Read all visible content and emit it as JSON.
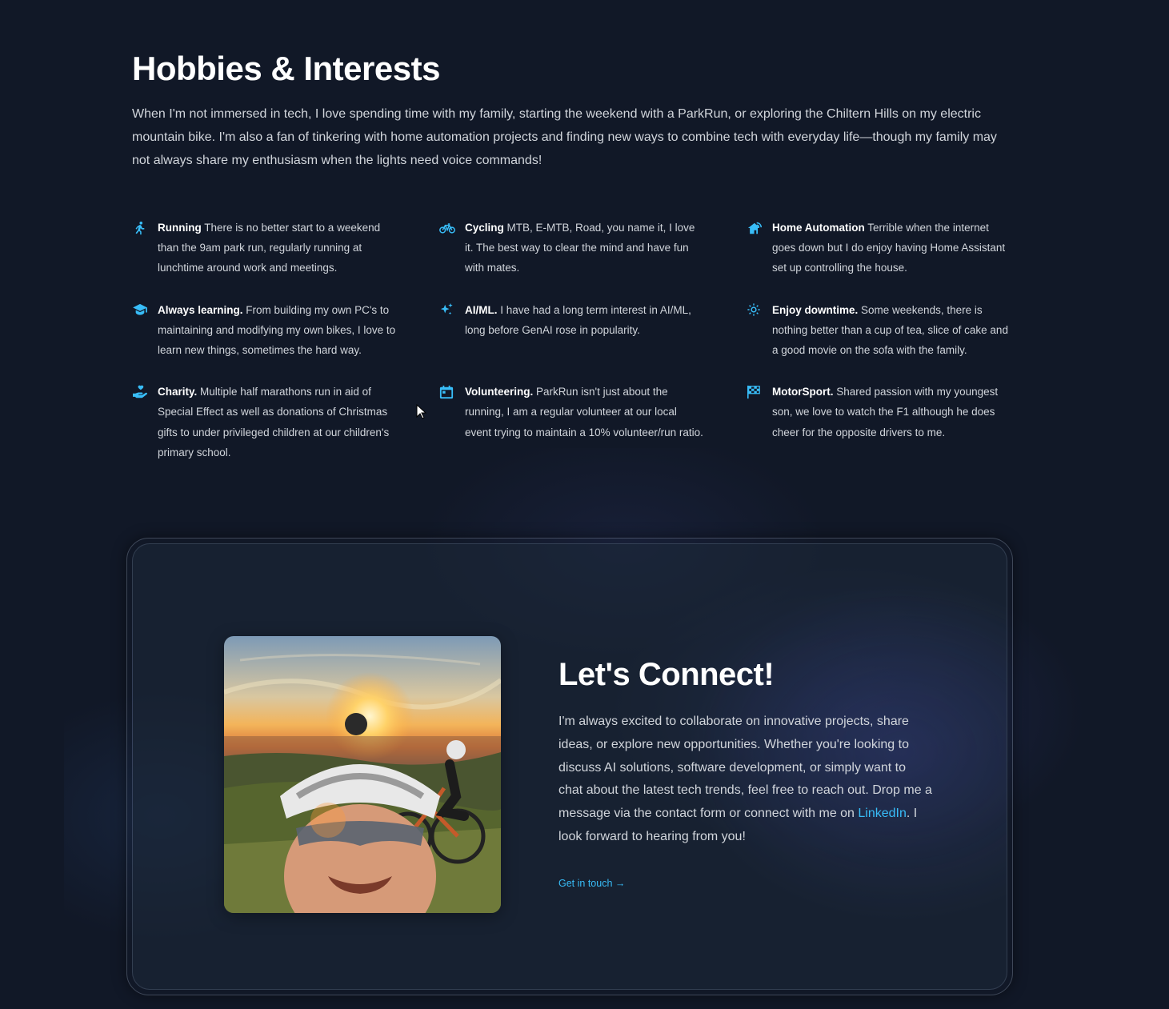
{
  "hobbies": {
    "title": "Hobbies & Interests",
    "intro": "When I'm not immersed in tech, I love spending time with my family, starting the weekend with a ParkRun, or exploring the Chiltern Hills on my electric mountain bike. I'm also a fan of tinkering with home automation projects and finding new ways to combine tech with everyday life—though my family may not always share my enthusiasm when the lights need voice commands!",
    "items": [
      {
        "icon": "running-icon",
        "title": "Running",
        "text": " There is no better start to a weekend than the 9am park run, regularly running at lunchtime around work and meetings."
      },
      {
        "icon": "bicycle-icon",
        "title": "Cycling",
        "text": " MTB, E-MTB, Road, you name it, I love it. The best way to clear the mind and have fun with mates."
      },
      {
        "icon": "home-wifi-icon",
        "title": "Home Automation",
        "text": " Terrible when the internet goes down but I do enjoy having Home Assistant set up controlling the house."
      },
      {
        "icon": "graduation-cap-icon",
        "title": "Always learning.",
        "text": " From building my own PC's to maintaining and modifying my own bikes, I love to learn new things, sometimes the hard way."
      },
      {
        "icon": "sparkles-icon",
        "title": "AI/ML.",
        "text": " I have had a long term interest in AI/ML, long before GenAI rose in popularity."
      },
      {
        "icon": "sun-icon",
        "title": "Enjoy downtime.",
        "text": " Some weekends, there is nothing better than a cup of tea, slice of cake and a good movie on the sofa with the family."
      },
      {
        "icon": "hand-heart-icon",
        "title": "Charity.",
        "text": " Multiple half marathons run in aid of Special Effect as well as donations of Christmas gifts to under privileged children at our children's primary school."
      },
      {
        "icon": "calendar-icon",
        "title": "Volunteering.",
        "text": " ParkRun isn't just about the running, I am a regular volunteer at our local event trying to maintain a 10% volunteer/run ratio."
      },
      {
        "icon": "checkered-flag-icon",
        "title": "MotorSport.",
        "text": " Shared passion with my youngest son, we love to watch the F1 although he does cheer for the opposite drivers to me."
      }
    ]
  },
  "connect": {
    "title": "Let's Connect!",
    "body_before": "I'm always excited to collaborate on innovative projects, share ideas, or explore new opportunities. Whether you're looking to discuss AI solutions, software development, or simply want to chat about the latest tech trends, feel free to reach out. Drop me a message via the contact form or connect with me on ",
    "link_label": "LinkedIn",
    "body_after": ". I look forward to hearing from you!",
    "cta_label": "Get in touch →",
    "photo_alt": "selfie-with-mountain-bikes-at-sunset"
  },
  "colors": {
    "background": "#111827",
    "accent": "#38bdf8",
    "icon": "#38bdf8",
    "heading": "#ffffff",
    "body": "#d1d5db"
  }
}
